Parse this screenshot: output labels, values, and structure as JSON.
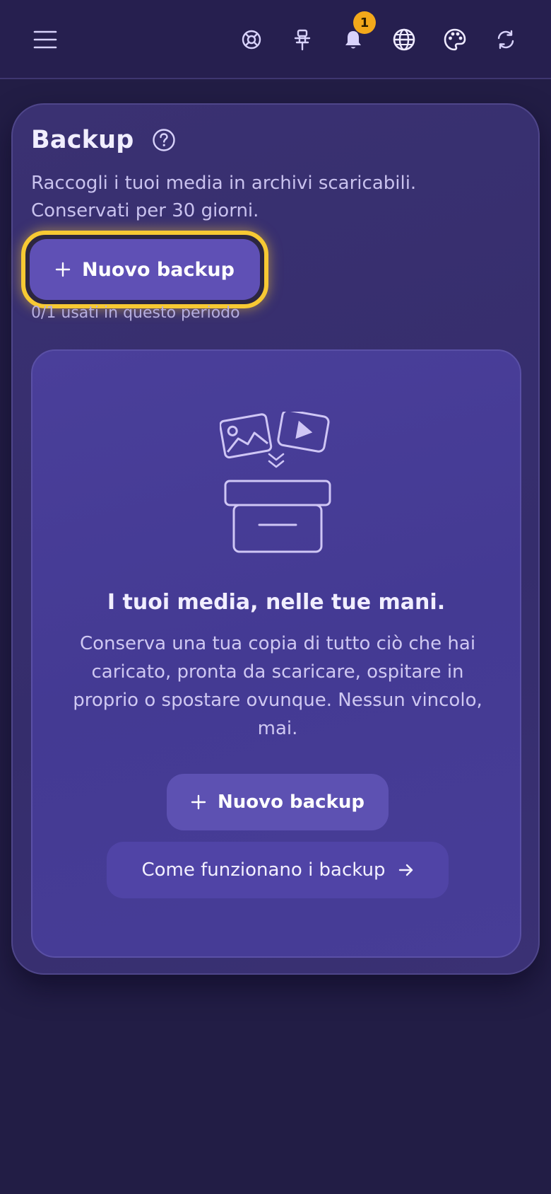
{
  "topbar": {
    "icons": {
      "menu": "menu-icon",
      "help": "lifebuoy-icon",
      "pin": "pin-icon",
      "notifications": "bell-icon",
      "language": "globe-icon",
      "theme": "palette-icon",
      "refresh": "refresh-icon"
    },
    "notification_count": "1"
  },
  "backup": {
    "title": "Backup",
    "description": "Raccogli i tuoi media in archivi scaricabili. Conservati per 30 giorni.",
    "new_backup_label": "Nuovo backup",
    "usage": "0/1 usati in questo periodo"
  },
  "empty_state": {
    "title": "I tuoi media, nelle tue mani.",
    "body": "Conserva una tua copia di tutto ciò che hai caricato, pronta da scaricare, ospitare in proprio o spostare ovunque. Nessun vincolo, mai.",
    "new_backup_label": "Nuovo backup",
    "how_it_works_label": "Come funzionano i backup"
  },
  "colors": {
    "background": "#221d45",
    "card": "#3a3172",
    "panel": "#4a3f9a",
    "primary_button": "#5f50b5",
    "focus_ring": "#f7c933",
    "badge": "#f3a81a"
  }
}
